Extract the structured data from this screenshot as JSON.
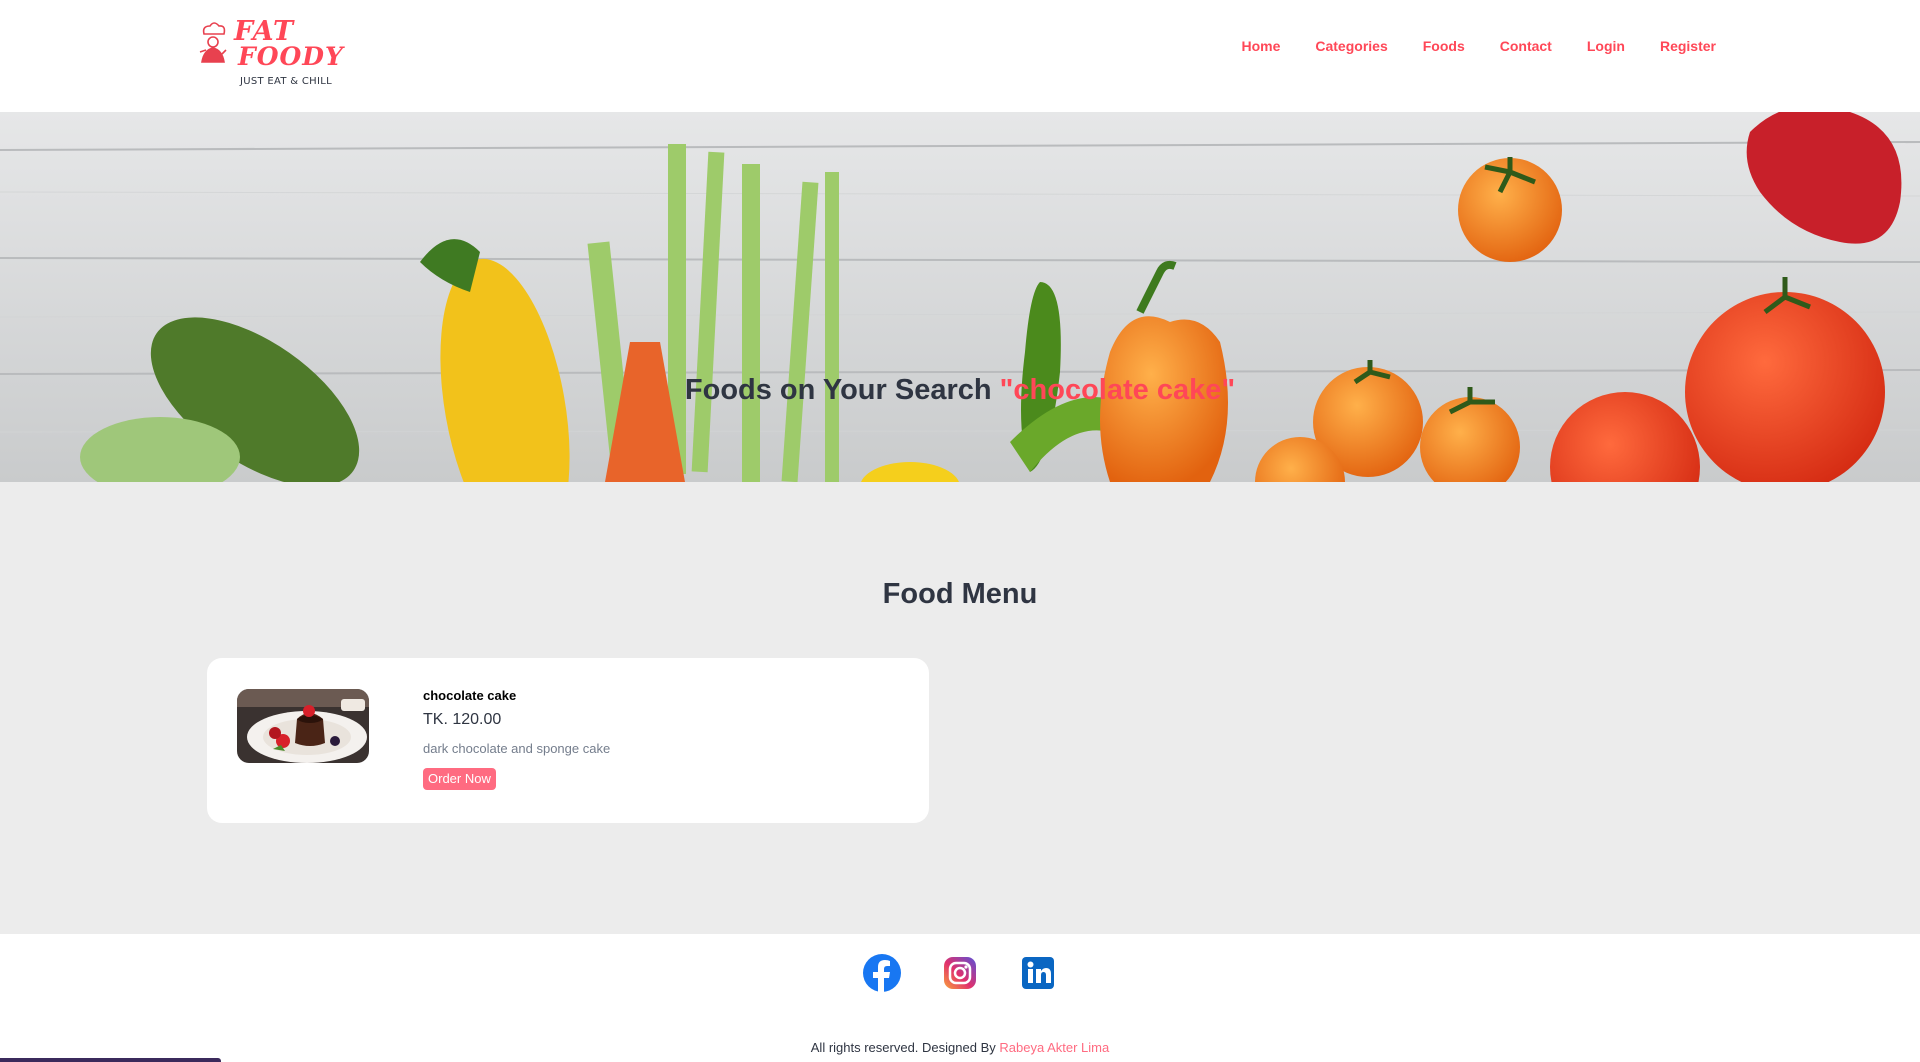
{
  "brand": {
    "name_line1": "FAT",
    "name_line2": "FOODY",
    "tagline": "JUST EAT & CHILL",
    "logo_icon": "chef-icon",
    "color": "#ff4757"
  },
  "nav": {
    "items": [
      {
        "label": "Home"
      },
      {
        "label": "Categories"
      },
      {
        "label": "Foods"
      },
      {
        "label": "Contact"
      },
      {
        "label": "Login"
      },
      {
        "label": "Register"
      }
    ]
  },
  "hero": {
    "title_prefix": "Foods on Your Search",
    "search_term": "\"chocolate cake\""
  },
  "food_menu": {
    "heading": "Food Menu",
    "items": [
      {
        "name": "chocolate cake",
        "price": "TK. 120.00",
        "description": "dark chocolate and sponge cake",
        "button": "Order Now"
      }
    ]
  },
  "social": {
    "icons": [
      "facebook-icon",
      "instagram-icon",
      "linkedin-icon"
    ]
  },
  "footer": {
    "text": "All rights reserved. Designed By",
    "author": "Rabeya Akter Lima"
  },
  "colors": {
    "accent": "#ff4757",
    "button": "#ff6b81",
    "section_bg": "#ececec",
    "heading": "#2f3542"
  }
}
